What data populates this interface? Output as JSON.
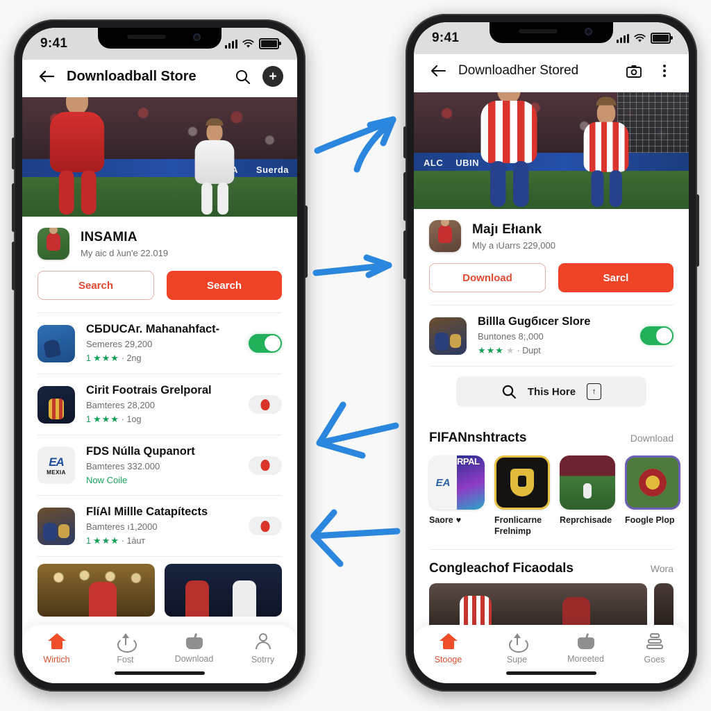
{
  "left_phone": {
    "status": {
      "time": "9:41",
      "signal_icon": "cellular-bars-icon",
      "wifi_icon": "wifi-icon",
      "battery_icon": "battery-icon"
    },
    "appbar": {
      "back_icon": "back-arrow-icon",
      "title": "Downloadball Store",
      "search_icon": "search-icon",
      "add_icon": "plus-icon"
    },
    "hero": {
      "ad_text_1": "MUA CA",
      "ad_text_2": "Suerda"
    },
    "featured": {
      "name": "INSAMIA",
      "subtitle": "My aic d λun'e 22.019",
      "button_outline": "Search",
      "button_solid": "Search"
    },
    "list": [
      {
        "title": "CБDUCAг. Mahanahfact-",
        "subtitle": "Semeres 29,200",
        "rating": "1",
        "stars": "★★★",
        "tail": "· 2ng",
        "toggle": "on"
      },
      {
        "title": "Cirit Footrais Grelporal",
        "subtitle": "Bamteres 28,200",
        "rating": "1",
        "stars": "★★★",
        "tail": "· 1og",
        "toggle": "off"
      },
      {
        "title": "FDS Núlla Qupanort",
        "subtitle": "Bamteres 332.000",
        "new_label": "Now Coile",
        "toggle": "off"
      },
      {
        "title": "FlíAl Millle Catapítects",
        "subtitle": "Bamteres ı1,2000",
        "rating": "1",
        "stars": "★★★",
        "tail": "· 1àuт",
        "toggle": "off"
      }
    ],
    "tabs": [
      {
        "label": "Wirtich",
        "icon": "home-icon",
        "active": true
      },
      {
        "label": "Fost",
        "icon": "upload-icon",
        "active": false
      },
      {
        "label": "Download",
        "icon": "basket-icon",
        "active": false
      },
      {
        "label": "Sotrry",
        "icon": "person-icon",
        "active": false
      }
    ]
  },
  "right_phone": {
    "status": {
      "time": "9:41",
      "signal_icon": "cellular-bars-icon",
      "wifi_icon": "wifi-icon",
      "battery_icon": "battery-icon"
    },
    "appbar": {
      "back_icon": "back-arrow-icon",
      "title": "Downloadher Stored",
      "camera_icon": "camera-icon",
      "menu_icon": "kebab-menu-icon"
    },
    "hero": {
      "ad_text_1": "ALC",
      "ad_text_2": "UBIN"
    },
    "featured": {
      "name": "Majı Ełıank",
      "subtitle": "Mly a ιUarrs 229,000",
      "button_outline": "Download",
      "button_solid": "Sarcl"
    },
    "list_item": {
      "title": "Billla Gugбıcer Slore",
      "subtitle": "Buntones 8;,000",
      "stars_filled": "★★★",
      "stars_empty": "★",
      "tail": "· Dupt",
      "toggle": "on"
    },
    "search_pill": {
      "icon": "search-icon",
      "label": "This Hore",
      "trailing_icon": "lock-upload-icon"
    },
    "section_apps": {
      "title": "FIFANnshtracts",
      "link": "Download",
      "tiles": [
        {
          "caption": "Saore",
          "badge": "♥",
          "art": "ea-rpal"
        },
        {
          "caption": "Fronlicarne Frelnimp",
          "art": "gold-crest"
        },
        {
          "caption": "Reprchisade",
          "art": "pitch-photo"
        },
        {
          "caption": "Foogle Plop",
          "art": "purple-crest"
        }
      ]
    },
    "section_media": {
      "title": "Congleachof Ficaodals",
      "link": "Wora"
    },
    "tabs": [
      {
        "label": "Stooge",
        "icon": "home-icon",
        "active": true
      },
      {
        "label": "Supe",
        "icon": "upload-icon",
        "active": false
      },
      {
        "label": "Moreeted",
        "icon": "basket-icon",
        "active": false
      },
      {
        "label": "Goes",
        "icon": "stack-icon",
        "active": false
      }
    ]
  },
  "annotations": {
    "arrow_color": "#2b87dd",
    "arrows": [
      {
        "name": "arrow-up-right",
        "direction": "up-right"
      },
      {
        "name": "arrow-right",
        "direction": "right"
      },
      {
        "name": "arrow-left-upper",
        "direction": "left"
      },
      {
        "name": "arrow-left-lower",
        "direction": "left"
      }
    ]
  },
  "theme": {
    "accent_red": "#ef4327",
    "toggle_green": "#22b05a",
    "star_green": "#15a05a",
    "page_bg": "#f8f8f8"
  }
}
